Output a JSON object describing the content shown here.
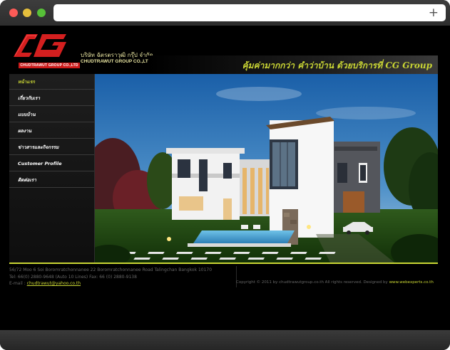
{
  "browser": {
    "new_tab_icon": "plus-icon"
  },
  "header": {
    "logo_text": "CG",
    "logo_caption": "CHUDTRAWUT GROUP CO.,LTD",
    "company_name_th": "บริษัท ฉัตรตราวุฒิ กรุ๊ป จำกัด",
    "company_name_en": "CHUDTRAWUT GROUP CO.,LTD",
    "slogan": "คุ้มค่ามากกว่า คำว่าบ้าน ด้วยบริการที่ CG Group"
  },
  "nav": {
    "items": [
      {
        "label": "หน้าแรก",
        "active": true
      },
      {
        "label": "เกี่ยวกับเรา",
        "active": false
      },
      {
        "label": "แบบบ้าน",
        "active": false
      },
      {
        "label": "ผลงาน",
        "active": false
      },
      {
        "label": "ข่าวสารและกิจกรรม",
        "active": false
      },
      {
        "label": "Customer Profile",
        "active": false
      },
      {
        "label": "ติดต่อเรา",
        "active": false
      }
    ]
  },
  "footer": {
    "address": "56/72 Moo 6 Soi Boromratchonnanee 22 Boromratchonnanee Road Talingchan Bangkok 10170",
    "tel": "Tel: 66(0) 2880-9648 (Auto 10 Lines)  Fax: 66 (0) 2880-9138",
    "email_label": "E-mail :",
    "email": "chudtrawut@yahoo.co.th",
    "copyright": "Copyright © 2011 by chudtrawutgroup.co.th All rights reserved. Designed by",
    "designer": "www.webexperts.co.th"
  },
  "colors": {
    "accent": "#c9d534",
    "brand_red": "#cc1a1a",
    "background": "#000000"
  }
}
